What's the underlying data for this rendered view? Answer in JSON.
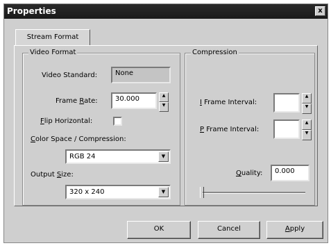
{
  "window": {
    "title": "Properties",
    "close_glyph": "x"
  },
  "tabs": [
    {
      "label": "Stream Format"
    }
  ],
  "video_format": {
    "group_label": "Video Format",
    "video_standard": {
      "label": "Video Standard:",
      "value": "None"
    },
    "frame_rate": {
      "label_pre": "Frame ",
      "label_u": "R",
      "label_post": "ate:",
      "value": "30.000"
    },
    "flip_horizontal": {
      "label_u": "F",
      "label_post": "lip Horizontal:",
      "checked": false
    },
    "color_space": {
      "label_u": "C",
      "label_post": "olor Space / Compression:",
      "value": "RGB 24"
    },
    "output_size": {
      "label_pre": "Output ",
      "label_u": "S",
      "label_post": "ize:",
      "value": "320 x 240"
    }
  },
  "compression": {
    "group_label": "Compression",
    "i_frame_interval": {
      "label_u": "I",
      "label_post": " Frame Interval:",
      "value": ""
    },
    "p_frame_interval": {
      "label_u": "P",
      "label_post": " Frame Interval:",
      "value": ""
    },
    "quality": {
      "label_u": "Q",
      "label_post": "uality:",
      "value": "0.000"
    },
    "slider_position": 0
  },
  "buttons": {
    "ok": "OK",
    "cancel": "Cancel",
    "apply_u": "A",
    "apply_post": "pply"
  }
}
